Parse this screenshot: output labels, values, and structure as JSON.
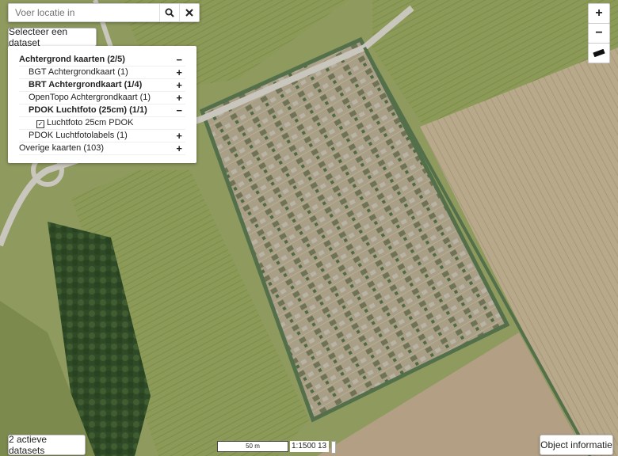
{
  "search": {
    "placeholder": "Voer locatie in",
    "search_icon": "search-icon",
    "clear_icon": "close-icon"
  },
  "select_dataset_label": "Selecteer een dataset",
  "layers": [
    {
      "label": "Achtergrond kaarten (2/5)",
      "toggle": "−",
      "level": 0,
      "bold": true
    },
    {
      "label": "BGT Achtergrondkaart (1)",
      "toggle": "+",
      "level": 1,
      "bold": false
    },
    {
      "label": "BRT Achtergrondkaart (1/4)",
      "toggle": "+",
      "level": 1,
      "bold": true
    },
    {
      "label": "OpenTopo Achtergrondkaart (1)",
      "toggle": "+",
      "level": 1,
      "bold": false
    },
    {
      "label": "PDOK Luchtfoto (25cm) (1/1)",
      "toggle": "−",
      "level": 1,
      "bold": true
    },
    {
      "label": "Luchtfoto 25cm PDOK",
      "toggle": "",
      "level": 2,
      "bold": false,
      "checked": true
    },
    {
      "label": "PDOK Luchtfotolabels (1)",
      "toggle": "+",
      "level": 1,
      "bold": false
    },
    {
      "label": "Overige kaarten (103)",
      "toggle": "+",
      "level": 0,
      "bold": false
    }
  ],
  "zoom_in_label": "+",
  "zoom_out_label": "−",
  "measure_icon": "ruler-icon",
  "active_datasets_label": "2 actieve datasets",
  "object_info_label": "Object informatie",
  "scale_bar_label": "50 m",
  "scale_ratio": "1:1500",
  "zoom_level": "13"
}
